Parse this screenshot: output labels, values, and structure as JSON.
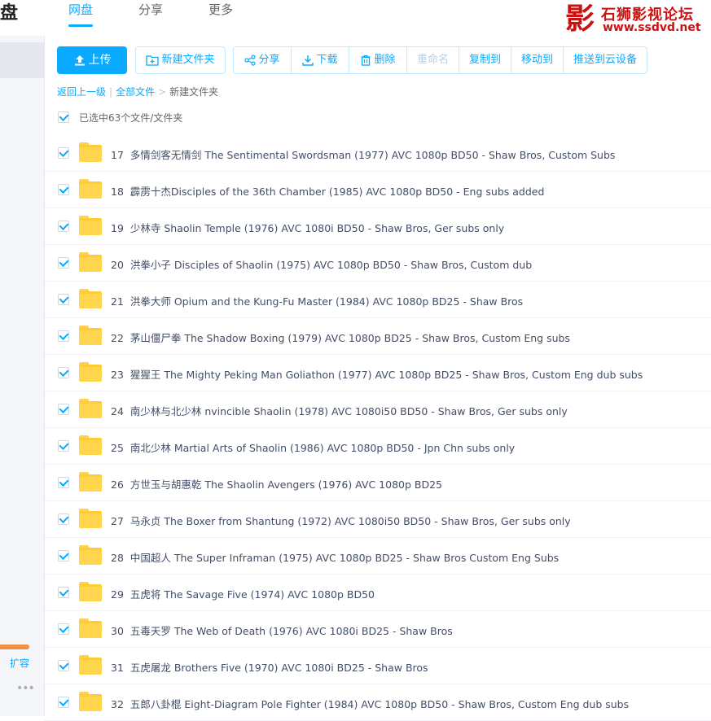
{
  "header": {
    "brand": "盘",
    "tabs": [
      {
        "label": "网盘",
        "active": true
      },
      {
        "label": "分享",
        "active": false
      },
      {
        "label": "更多",
        "active": false
      }
    ]
  },
  "watermark": {
    "logo": "影",
    "title": "石狮影视论坛",
    "url": "www.ssdvd.net"
  },
  "sidebar": {
    "expand_label": "扩容",
    "more_label": "•••"
  },
  "toolbar": {
    "upload": "上传",
    "new_folder": "新建文件夹",
    "share": "分享",
    "download": "下载",
    "delete": "删除",
    "rename": "重命名",
    "copy_to": "复制到",
    "move_to": "移动到",
    "push_device": "推送到云设备"
  },
  "breadcrumb": {
    "back": "返回上一级",
    "all_files": "全部文件",
    "current": "新建文件夹"
  },
  "selection": {
    "text": "已选中63个文件/文件夹"
  },
  "files": [
    {
      "index": "17",
      "name": "多情剑客无情剑 The Sentimental Swordsman (1977) AVC 1080p BD50 - Shaw Bros, Custom Subs"
    },
    {
      "index": "18",
      "name": "霹雳十杰Disciples of the 36th Chamber (1985) AVC 1080p BD50 - Eng subs added"
    },
    {
      "index": "19",
      "name": "少林寺 Shaolin Temple (1976) AVC 1080i BD50 - Shaw Bros, Ger subs only"
    },
    {
      "index": "20",
      "name": "洪拳小子 Disciples of Shaolin (1975) AVC 1080p BD50 - Shaw Bros, Custom dub"
    },
    {
      "index": "21",
      "name": "洪拳大师 Opium and the Kung-Fu Master (1984) AVC 1080p BD25 - Shaw Bros"
    },
    {
      "index": "22",
      "name": "茅山僵尸拳 The Shadow Boxing (1979) AVC 1080p BD25 - Shaw Bros, Custom Eng subs"
    },
    {
      "index": "23",
      "name": "猩猩王 The Mighty Peking Man Goliathon (1977) AVC 1080p BD25 - Shaw Bros, Custom Eng dub subs"
    },
    {
      "index": "24",
      "name": "南少林与北少林 nvincible Shaolin (1978) AVC 1080i50 BD50 - Shaw Bros, Ger subs only"
    },
    {
      "index": "25",
      "name": "南北少林 Martial Arts of Shaolin (1986) AVC 1080p BD50 - Jpn Chn subs only"
    },
    {
      "index": "26",
      "name": "方世玉与胡惠乾 The Shaolin Avengers (1976) AVC 1080p BD25"
    },
    {
      "index": "27",
      "name": "马永贞 The Boxer from Shantung (1972) AVC 1080i50 BD50 - Shaw Bros, Ger subs only"
    },
    {
      "index": "28",
      "name": "中国超人 The Super Inframan (1975) AVC 1080p BD25 - Shaw Bros Custom Eng Subs"
    },
    {
      "index": "29",
      "name": "五虎将 The Savage Five (1974) AVC 1080p BD50"
    },
    {
      "index": "30",
      "name": "五毒天罗 The Web of Death (1976) AVC 1080i BD25 - Shaw Bros"
    },
    {
      "index": "31",
      "name": "五虎屠龙 Brothers Five (1970) AVC 1080i BD25 - Shaw Bros"
    },
    {
      "index": "32",
      "name": "五郎八卦棍 Eight-Diagram Pole Fighter (1984) AVC 1080p BD50 - Shaw Bros, Custom Eng dub subs"
    }
  ],
  "colors": {
    "accent": "#09AAFF",
    "folder": "#FFCC33",
    "watermark": "#CC1111",
    "expand_bar": "#F09045"
  }
}
